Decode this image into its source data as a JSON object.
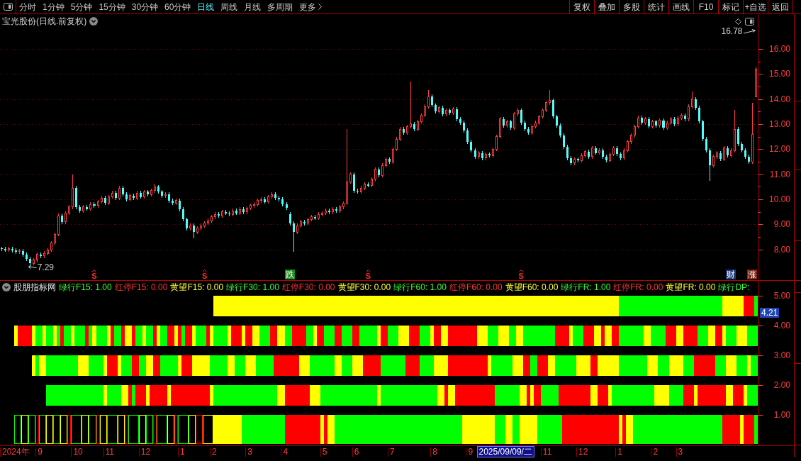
{
  "toolbar": {
    "tabs": [
      {
        "label": "分时",
        "kind": "period",
        "selected": false
      },
      {
        "label": "1分钟",
        "kind": "period",
        "selected": false
      },
      {
        "label": "5分钟",
        "kind": "period",
        "selected": false
      },
      {
        "label": "15分钟",
        "kind": "period",
        "selected": false
      },
      {
        "label": "30分钟",
        "kind": "period",
        "selected": false
      },
      {
        "label": "60分钟",
        "kind": "period",
        "selected": false
      },
      {
        "label": "日线",
        "kind": "period",
        "selected": true
      },
      {
        "label": "周线",
        "kind": "period",
        "selected": false
      },
      {
        "label": "月线",
        "kind": "period",
        "selected": false
      },
      {
        "label": "多周期",
        "kind": "period",
        "selected": false
      },
      {
        "label": "更多",
        "kind": "menu",
        "selected": false
      }
    ],
    "buttons": [
      "复权",
      "叠加",
      "多股",
      "统计",
      "画线",
      "F10",
      "标记",
      "+自选",
      "返回"
    ]
  },
  "price_chart": {
    "high_label": "16.78",
    "low_label": "7.29",
    "signals": [
      {
        "kind": "signal",
        "text": "S"
      },
      {
        "kind": "signal",
        "text": "S"
      },
      {
        "kind": "tag",
        "text": "跌",
        "color": "#178a17"
      },
      {
        "kind": "signal",
        "text": "S"
      },
      {
        "kind": "signal",
        "text": "S"
      },
      {
        "kind": "tag",
        "text": "财",
        "color": "#1c3a78"
      },
      {
        "kind": "tag",
        "text": "涨",
        "color": "#7a2410"
      }
    ],
    "chart_data": [
      {
        "type": "candlestick",
        "title": "宝光股份(日线.前复权)",
        "grid": true,
        "ylim": [
          6.78,
          17.38
        ],
        "yticks": [
          {
            "value": 16,
            "label": "16.00"
          },
          {
            "value": 15,
            "label": "15.00"
          },
          {
            "value": 14,
            "label": "14.00"
          },
          {
            "value": 13,
            "label": "13.00"
          },
          {
            "value": 12,
            "label": "12.00"
          },
          {
            "value": 11,
            "label": "11.00"
          },
          {
            "value": 10,
            "label": "10.00"
          },
          {
            "value": 9,
            "label": "9.00"
          },
          {
            "value": 8,
            "label": "8.00"
          }
        ],
        "ohlc": [
          [
            8.05,
            8.12,
            7.95,
            8.02
          ],
          [
            8.02,
            8.1,
            7.9,
            7.98
          ],
          [
            7.98,
            8.11,
            7.9,
            8.03
          ],
          [
            8.03,
            8.11,
            7.88,
            7.96
          ],
          [
            7.96,
            8.04,
            7.84,
            7.92
          ],
          [
            7.92,
            8.03,
            7.84,
            7.95
          ],
          [
            7.95,
            8.03,
            7.72,
            7.8
          ],
          [
            7.8,
            7.88,
            7.54,
            7.62
          ],
          [
            7.62,
            7.7,
            7.29,
            7.45
          ],
          [
            7.45,
            7.66,
            7.37,
            7.58
          ],
          [
            7.58,
            7.88,
            7.5,
            7.8
          ],
          [
            7.8,
            7.88,
            7.67,
            7.75
          ],
          [
            7.75,
            7.93,
            7.67,
            7.85
          ],
          [
            7.85,
            8.06,
            7.77,
            7.98
          ],
          [
            7.98,
            8.33,
            7.9,
            8.25
          ],
          [
            8.25,
            8.68,
            8.17,
            8.6
          ],
          [
            8.6,
            9.43,
            8.52,
            9.35
          ],
          [
            9.35,
            9.43,
            9.02,
            9.1
          ],
          [
            9.1,
            9.53,
            9.02,
            9.45
          ],
          [
            9.45,
            9.78,
            9.37,
            9.7
          ],
          [
            9.7,
            11.0,
            9.62,
            10.45
          ],
          [
            10.45,
            10.53,
            9.62,
            9.7
          ],
          [
            9.7,
            9.78,
            9.47,
            9.55
          ],
          [
            9.55,
            9.78,
            9.47,
            9.7
          ],
          [
            9.7,
            9.78,
            9.54,
            9.62
          ],
          [
            9.62,
            9.88,
            9.54,
            9.8
          ],
          [
            9.8,
            9.88,
            9.67,
            9.75
          ],
          [
            9.75,
            9.98,
            9.67,
            9.9
          ],
          [
            9.9,
            10.13,
            9.82,
            10.05
          ],
          [
            10.05,
            10.13,
            9.77,
            9.85
          ],
          [
            9.85,
            10.18,
            9.77,
            10.1
          ],
          [
            10.1,
            10.33,
            10.02,
            10.25
          ],
          [
            10.25,
            10.33,
            9.97,
            10.05
          ],
          [
            10.05,
            10.53,
            9.97,
            10.45
          ],
          [
            10.45,
            10.53,
            10.12,
            10.2
          ],
          [
            10.2,
            10.28,
            9.92,
            10.0
          ],
          [
            10.0,
            10.23,
            9.92,
            10.15
          ],
          [
            10.15,
            10.23,
            9.97,
            10.05
          ],
          [
            10.05,
            10.33,
            9.97,
            10.25
          ],
          [
            10.25,
            10.33,
            10.02,
            10.1
          ],
          [
            10.1,
            10.38,
            10.02,
            10.3
          ],
          [
            10.3,
            10.38,
            10.12,
            10.2
          ],
          [
            10.2,
            10.43,
            10.12,
            10.35
          ],
          [
            10.35,
            10.62,
            10.27,
            10.5
          ],
          [
            10.5,
            10.58,
            10.22,
            10.3
          ],
          [
            10.3,
            10.38,
            10.07,
            10.15
          ],
          [
            10.15,
            10.28,
            10.07,
            10.2
          ],
          [
            10.2,
            10.28,
            9.87,
            9.95
          ],
          [
            9.95,
            10.03,
            9.77,
            9.85
          ],
          [
            9.85,
            10.03,
            9.77,
            9.95
          ],
          [
            9.95,
            10.03,
            9.52,
            9.6
          ],
          [
            9.6,
            9.68,
            9.12,
            9.2
          ],
          [
            9.2,
            9.28,
            8.77,
            8.85
          ],
          [
            8.85,
            9.03,
            8.77,
            8.95
          ],
          [
            8.95,
            9.03,
            8.45,
            8.7
          ],
          [
            8.7,
            8.93,
            8.62,
            8.85
          ],
          [
            8.85,
            9.03,
            8.77,
            8.95
          ],
          [
            8.95,
            9.13,
            8.87,
            9.05
          ],
          [
            9.05,
            9.23,
            8.97,
            9.15
          ],
          [
            9.15,
            9.38,
            9.07,
            9.3
          ],
          [
            9.3,
            9.48,
            9.22,
            9.4
          ],
          [
            9.4,
            9.48,
            9.27,
            9.35
          ],
          [
            9.35,
            9.58,
            9.27,
            9.5
          ],
          [
            9.5,
            9.58,
            9.37,
            9.45
          ],
          [
            9.45,
            9.53,
            9.32,
            9.4
          ],
          [
            9.4,
            9.63,
            9.32,
            9.55
          ],
          [
            9.55,
            9.63,
            9.37,
            9.45
          ],
          [
            9.45,
            9.68,
            9.37,
            9.6
          ],
          [
            9.6,
            9.68,
            9.42,
            9.5
          ],
          [
            9.5,
            9.73,
            9.42,
            9.65
          ],
          [
            9.65,
            9.83,
            9.57,
            9.75
          ],
          [
            9.75,
            9.88,
            9.67,
            9.8
          ],
          [
            9.8,
            10.03,
            9.72,
            9.95
          ],
          [
            9.95,
            10.08,
            9.87,
            10.0
          ],
          [
            10.0,
            10.08,
            9.82,
            9.9
          ],
          [
            9.9,
            10.18,
            9.82,
            10.1
          ],
          [
            10.1,
            10.28,
            10.02,
            10.2
          ],
          [
            10.2,
            10.28,
            9.97,
            10.05
          ],
          [
            10.05,
            10.13,
            9.92,
            10.0
          ],
          [
            10.0,
            10.08,
            9.72,
            9.8
          ],
          [
            9.8,
            9.88,
            9.57,
            9.65
          ],
          [
            9.4,
            9.48,
            8.97,
            9.05
          ],
          [
            9.05,
            9.13,
            7.9,
            8.7
          ],
          [
            8.7,
            9.03,
            8.62,
            8.95
          ],
          [
            8.95,
            9.18,
            8.87,
            9.1
          ],
          [
            9.1,
            9.18,
            8.97,
            9.05
          ],
          [
            9.05,
            9.28,
            8.97,
            9.2
          ],
          [
            9.2,
            9.38,
            9.12,
            9.3
          ],
          [
            9.3,
            9.38,
            9.17,
            9.25
          ],
          [
            9.25,
            9.48,
            9.17,
            9.4
          ],
          [
            9.4,
            9.53,
            9.32,
            9.45
          ],
          [
            9.45,
            9.63,
            9.37,
            9.55
          ],
          [
            9.55,
            9.63,
            9.42,
            9.5
          ],
          [
            9.5,
            9.68,
            9.42,
            9.6
          ],
          [
            9.6,
            9.68,
            9.47,
            9.55
          ],
          [
            9.55,
            9.78,
            9.47,
            9.7
          ],
          [
            9.7,
            9.93,
            9.62,
            9.85
          ],
          [
            9.85,
            12.8,
            9.77,
            10.7
          ],
          [
            10.7,
            11.08,
            10.62,
            11.0
          ],
          [
            11.0,
            11.08,
            10.27,
            10.35
          ],
          [
            10.35,
            10.43,
            10.22,
            10.3
          ],
          [
            10.3,
            10.53,
            10.22,
            10.45
          ],
          [
            10.45,
            10.68,
            10.37,
            10.6
          ],
          [
            10.6,
            10.68,
            10.47,
            10.55
          ],
          [
            10.55,
            10.88,
            10.47,
            10.8
          ],
          [
            10.8,
            11.28,
            10.72,
            11.2
          ],
          [
            11.2,
            11.28,
            10.87,
            10.95
          ],
          [
            10.95,
            11.43,
            10.87,
            11.35
          ],
          [
            11.35,
            11.68,
            11.27,
            11.6
          ],
          [
            11.6,
            11.68,
            11.42,
            11.5
          ],
          [
            11.5,
            12.08,
            11.42,
            12.0
          ],
          [
            12.0,
            12.48,
            11.92,
            12.4
          ],
          [
            12.4,
            12.88,
            12.32,
            12.8
          ],
          [
            12.8,
            12.88,
            12.57,
            12.65
          ],
          [
            12.65,
            12.98,
            12.57,
            12.9
          ],
          [
            12.9,
            14.7,
            12.82,
            13.0
          ],
          [
            13.0,
            13.08,
            12.72,
            12.8
          ],
          [
            12.8,
            13.18,
            12.72,
            13.1
          ],
          [
            13.1,
            13.43,
            13.02,
            13.35
          ],
          [
            13.35,
            13.78,
            13.27,
            13.7
          ],
          [
            13.7,
            14.35,
            13.62,
            14.1
          ],
          [
            14.1,
            14.18,
            13.67,
            13.75
          ],
          [
            13.75,
            13.83,
            13.42,
            13.5
          ],
          [
            13.5,
            13.73,
            13.42,
            13.65
          ],
          [
            13.65,
            13.73,
            13.32,
            13.4
          ],
          [
            13.4,
            13.63,
            13.32,
            13.55
          ],
          [
            13.55,
            13.63,
            13.37,
            13.45
          ],
          [
            13.45,
            13.68,
            13.37,
            13.6
          ],
          [
            13.6,
            13.68,
            13.12,
            13.2
          ],
          [
            13.2,
            13.28,
            12.97,
            13.05
          ],
          [
            13.05,
            13.13,
            12.67,
            12.75
          ],
          [
            12.75,
            12.83,
            12.22,
            12.3
          ],
          [
            12.3,
            12.38,
            11.87,
            11.95
          ],
          [
            11.95,
            12.03,
            11.62,
            11.7
          ],
          [
            11.7,
            11.93,
            11.62,
            11.85
          ],
          [
            11.85,
            11.93,
            11.57,
            11.65
          ],
          [
            11.65,
            11.88,
            11.57,
            11.8
          ],
          [
            11.8,
            11.88,
            11.67,
            11.75
          ],
          [
            11.75,
            12.08,
            11.67,
            12.0
          ],
          [
            12.0,
            12.58,
            11.92,
            12.5
          ],
          [
            12.5,
            13.28,
            12.42,
            13.2
          ],
          [
            13.2,
            13.28,
            12.87,
            12.95
          ],
          [
            12.95,
            13.18,
            12.87,
            13.1
          ],
          [
            13.1,
            13.18,
            12.77,
            12.85
          ],
          [
            12.85,
            13.48,
            12.77,
            13.4
          ],
          [
            13.4,
            13.63,
            13.32,
            13.55
          ],
          [
            13.55,
            13.63,
            12.97,
            13.05
          ],
          [
            13.05,
            13.13,
            12.72,
            12.8
          ],
          [
            12.8,
            12.88,
            12.57,
            12.65
          ],
          [
            12.65,
            12.98,
            12.57,
            12.9
          ],
          [
            12.9,
            13.13,
            12.82,
            13.05
          ],
          [
            13.05,
            13.38,
            12.97,
            13.3
          ],
          [
            13.3,
            13.63,
            13.22,
            13.55
          ],
          [
            13.55,
            13.93,
            13.47,
            13.85
          ],
          [
            13.85,
            14.35,
            13.77,
            13.95
          ],
          [
            13.95,
            14.03,
            13.22,
            13.3
          ],
          [
            13.3,
            13.38,
            12.87,
            12.95
          ],
          [
            12.95,
            13.03,
            12.47,
            12.55
          ],
          [
            12.55,
            12.63,
            12.02,
            12.1
          ],
          [
            12.1,
            12.18,
            11.57,
            11.65
          ],
          [
            11.65,
            11.73,
            11.37,
            11.45
          ],
          [
            11.45,
            11.68,
            11.37,
            11.6
          ],
          [
            11.6,
            11.68,
            11.47,
            11.55
          ],
          [
            11.55,
            11.83,
            11.47,
            11.75
          ],
          [
            11.75,
            11.98,
            11.67,
            11.9
          ],
          [
            11.9,
            11.98,
            11.62,
            11.7
          ],
          [
            11.7,
            12.13,
            11.62,
            12.05
          ],
          [
            12.05,
            12.13,
            11.77,
            11.85
          ],
          [
            11.85,
            12.03,
            11.77,
            11.95
          ],
          [
            11.95,
            12.03,
            11.62,
            11.7
          ],
          [
            11.7,
            11.78,
            11.47,
            11.55
          ],
          [
            11.55,
            11.88,
            11.47,
            11.8
          ],
          [
            11.8,
            12.13,
            11.72,
            12.05
          ],
          [
            12.05,
            12.13,
            11.72,
            11.8
          ],
          [
            11.8,
            11.88,
            11.57,
            11.65
          ],
          [
            11.65,
            12.03,
            11.57,
            11.95
          ],
          [
            11.95,
            12.38,
            11.87,
            12.3
          ],
          [
            12.3,
            12.63,
            12.22,
            12.55
          ],
          [
            12.55,
            12.98,
            12.47,
            12.9
          ],
          [
            12.9,
            13.33,
            12.82,
            13.25
          ],
          [
            13.25,
            13.33,
            12.97,
            13.05
          ],
          [
            13.05,
            13.28,
            12.97,
            13.2
          ],
          [
            13.2,
            13.28,
            12.82,
            12.9
          ],
          [
            12.9,
            13.18,
            12.82,
            13.1
          ],
          [
            13.1,
            13.18,
            12.87,
            12.95
          ],
          [
            12.95,
            13.23,
            12.87,
            13.15
          ],
          [
            13.15,
            13.23,
            12.77,
            12.85
          ],
          [
            12.85,
            13.13,
            12.77,
            13.05
          ],
          [
            13.05,
            13.28,
            12.97,
            13.2
          ],
          [
            13.2,
            13.28,
            12.92,
            13.0
          ],
          [
            13.0,
            13.33,
            12.92,
            13.25
          ],
          [
            13.25,
            13.43,
            13.17,
            13.35
          ],
          [
            13.35,
            13.43,
            13.12,
            13.2
          ],
          [
            13.2,
            13.78,
            13.12,
            13.7
          ],
          [
            13.7,
            14.3,
            13.62,
            14.0
          ],
          [
            14.0,
            14.08,
            13.57,
            13.65
          ],
          [
            13.65,
            13.73,
            13.02,
            13.1
          ],
          [
            13.1,
            13.18,
            12.32,
            12.4
          ],
          [
            12.4,
            12.48,
            11.87,
            11.95
          ],
          [
            11.95,
            12.03,
            10.75,
            11.35
          ],
          [
            11.35,
            11.78,
            11.27,
            11.7
          ],
          [
            11.7,
            11.93,
            11.62,
            11.85
          ],
          [
            11.85,
            11.93,
            11.52,
            11.6
          ],
          [
            11.6,
            12.13,
            11.52,
            12.05
          ],
          [
            12.05,
            12.13,
            11.67,
            11.75
          ],
          [
            11.75,
            12.03,
            11.67,
            11.95
          ],
          [
            11.95,
            13.55,
            11.87,
            12.8
          ],
          [
            12.8,
            12.88,
            12.12,
            12.2
          ],
          [
            12.2,
            12.28,
            11.87,
            11.95
          ],
          [
            11.95,
            12.03,
            11.62,
            11.7
          ],
          [
            11.7,
            11.78,
            11.42,
            11.5
          ],
          [
            11.5,
            13.85,
            11.42,
            12.6
          ],
          [
            14.1,
            15.3,
            14.1,
            15.2
          ]
        ]
      }
    ]
  },
  "indicator": {
    "title": "股朋指标网",
    "readouts": [
      {
        "text": "绿行F15: 1.00",
        "color": "#33ff33"
      },
      {
        "text": "红停F15: 0.00",
        "color": "#ff3333"
      },
      {
        "text": "黄望F15: 0.00",
        "color": "#ffff33"
      },
      {
        "text": "绿行F30: 1.00",
        "color": "#33ff33"
      },
      {
        "text": "红停F30: 0.00",
        "color": "#ff3333"
      },
      {
        "text": "黄望F30: 0.00",
        "color": "#ffff33"
      },
      {
        "text": "绿行F60: 1.00",
        "color": "#33ff33"
      },
      {
        "text": "红停F60: 0.00",
        "color": "#ff3333"
      },
      {
        "text": "黄望F60: 0.00",
        "color": "#ffff33"
      },
      {
        "text": "绿行FR: 1.00",
        "color": "#33ff33"
      },
      {
        "text": "红停FR: 0.00",
        "color": "#ff3333"
      },
      {
        "text": "黄望FR: 0.00",
        "color": "#ffff33"
      },
      {
        "text": "绿行DP:",
        "color": "#33ff33"
      }
    ],
    "scale_labels": [
      "5.00",
      "4.00",
      "3.00",
      "2.00",
      "1.00"
    ],
    "cursor_value": "4.21"
  },
  "date_axis": {
    "labels": [
      "2024年",
      "9",
      "10",
      "11",
      "12",
      "1",
      "2",
      "3",
      "4",
      "5",
      "6",
      "7",
      "8",
      "9",
      "11",
      "12",
      "1",
      "2",
      "3"
    ],
    "cursor_date": "2025/09/09/二"
  }
}
